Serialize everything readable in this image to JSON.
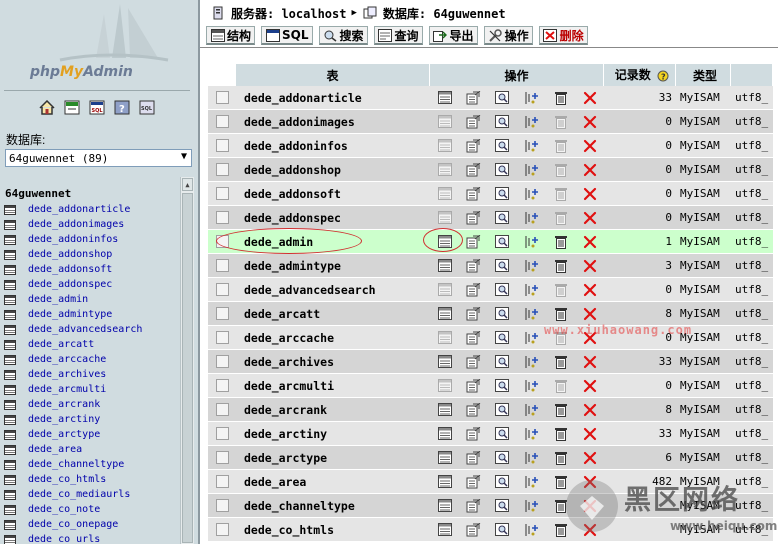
{
  "left": {
    "logo_php": "php",
    "logo_my": "My",
    "logo_admin": "Admin",
    "database_label": "数据库:",
    "selected_database": "64guwennet (89)",
    "current_db": "64guwennet",
    "tables": [
      "dede_addonarticle",
      "dede_addonimages",
      "dede_addoninfos",
      "dede_addonshop",
      "dede_addonsoft",
      "dede_addonspec",
      "dede_admin",
      "dede_admintype",
      "dede_advancedsearch",
      "dede_arcatt",
      "dede_arccache",
      "dede_archives",
      "dede_arcmulti",
      "dede_arcrank",
      "dede_arctiny",
      "dede_arctype",
      "dede_area",
      "dede_channeltype",
      "dede_co_htmls",
      "dede_co_mediaurls",
      "dede_co_note",
      "dede_co_onepage",
      "dede_co_urls"
    ]
  },
  "breadcrumb": {
    "server_label": "服务器: localhost",
    "db_label": "数据库: 64guwennet"
  },
  "tabs": [
    {
      "label": "结构",
      "icon": "structure-icon"
    },
    {
      "label": "SQL",
      "icon": "sql-icon"
    },
    {
      "label": "搜索",
      "icon": "search-icon"
    },
    {
      "label": "查询",
      "icon": "query-icon"
    },
    {
      "label": "导出",
      "icon": "export-icon"
    },
    {
      "label": "操作",
      "icon": "operations-icon"
    },
    {
      "label": "删除",
      "icon": "delete-icon"
    }
  ],
  "table_headers": {
    "table": "表",
    "actions": "操作",
    "records": "记录数",
    "type": "类型"
  },
  "rows": [
    {
      "name": "dede_addonarticle",
      "records": "33",
      "type": "MyISAM",
      "collation": "utf8_",
      "empty": false
    },
    {
      "name": "dede_addonimages",
      "records": "0",
      "type": "MyISAM",
      "collation": "utf8_",
      "empty": true
    },
    {
      "name": "dede_addoninfos",
      "records": "0",
      "type": "MyISAM",
      "collation": "utf8_",
      "empty": true
    },
    {
      "name": "dede_addonshop",
      "records": "0",
      "type": "MyISAM",
      "collation": "utf8_",
      "empty": true
    },
    {
      "name": "dede_addonsoft",
      "records": "0",
      "type": "MyISAM",
      "collation": "utf8_",
      "empty": true
    },
    {
      "name": "dede_addonspec",
      "records": "0",
      "type": "MyISAM",
      "collation": "utf8_",
      "empty": true
    },
    {
      "name": "dede_admin",
      "records": "1",
      "type": "MyISAM",
      "collation": "utf8_",
      "empty": false,
      "highlight": true
    },
    {
      "name": "dede_admintype",
      "records": "3",
      "type": "MyISAM",
      "collation": "utf8_",
      "empty": false
    },
    {
      "name": "dede_advancedsearch",
      "records": "0",
      "type": "MyISAM",
      "collation": "utf8_",
      "empty": true
    },
    {
      "name": "dede_arcatt",
      "records": "8",
      "type": "MyISAM",
      "collation": "utf8_",
      "empty": false
    },
    {
      "name": "dede_arccache",
      "records": "0",
      "type": "MyISAM",
      "collation": "utf8_",
      "empty": true
    },
    {
      "name": "dede_archives",
      "records": "33",
      "type": "MyISAM",
      "collation": "utf8_",
      "empty": false
    },
    {
      "name": "dede_arcmulti",
      "records": "0",
      "type": "MyISAM",
      "collation": "utf8_",
      "empty": true
    },
    {
      "name": "dede_arcrank",
      "records": "8",
      "type": "MyISAM",
      "collation": "utf8_",
      "empty": false
    },
    {
      "name": "dede_arctiny",
      "records": "33",
      "type": "MyISAM",
      "collation": "utf8_",
      "empty": false
    },
    {
      "name": "dede_arctype",
      "records": "6",
      "type": "MyISAM",
      "collation": "utf8_",
      "empty": false
    },
    {
      "name": "dede_area",
      "records": "482",
      "type": "MyISAM",
      "collation": "utf8_",
      "empty": false
    },
    {
      "name": "dede_channeltype",
      "records": "",
      "type": "MyISAM",
      "collation": "utf8_",
      "empty": false
    },
    {
      "name": "dede_co_htmls",
      "records": "",
      "type": "MyISAM",
      "collation": "utf8_",
      "empty": false
    }
  ],
  "watermark": "www.xiuhaowang.com",
  "corner_watermark": {
    "cn": "黑区网络",
    "url": "www.heiqu.com"
  }
}
